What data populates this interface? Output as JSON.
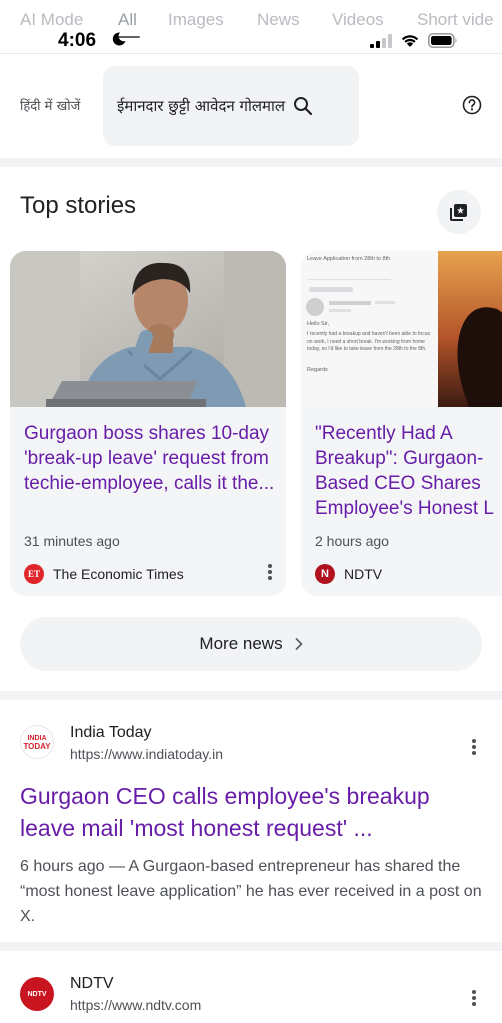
{
  "tabs": [
    "AI Mode",
    "All",
    "Images",
    "News",
    "Videos",
    "Short vide"
  ],
  "status": {
    "time": "4:06"
  },
  "search": {
    "hindi_label": "हिंदी में खोजें",
    "query": "ईमानदार छुट्टी आवेदन गोलमाल"
  },
  "top_stories": {
    "title": "Top stories",
    "cards": [
      {
        "title": "Gurgaon boss shares 10-day 'break-up leave' request from techie-employee, calls it the...",
        "time": "31 minutes ago",
        "source": "The Economic Times",
        "logo_text": "ET",
        "logo_color": "#e0252b"
      },
      {
        "title": "\"Recently Had A Breakup\": Gurgaon-Based CEO Shares Employee's Honest L",
        "time": "2 hours ago",
        "source": "NDTV",
        "logo_text": "N",
        "logo_color": "#b0121e"
      }
    ],
    "email_mock": {
      "subject": "Leave Application from 28th to 8th",
      "body": "I recently had a breakup and haven't been able to focus on work, I need a short break. I'm working from home today, so I'd like to take leave from the 28th to the 8th.",
      "greeting": "Hello Sir,",
      "signoff": "Regards"
    },
    "more_news": "More news"
  },
  "results": [
    {
      "site": "India Today",
      "url": "https://www.indiatoday.in",
      "title": "Gurgaon CEO calls employee's breakup leave mail 'most honest request' ...",
      "snippet": "6 hours ago — A Gurgaon-based entrepreneur has shared the “most honest leave application” he has ever received in a post on X.",
      "logo_color": "#d6232d"
    },
    {
      "site": "NDTV",
      "url": "https://www.ndtv.com",
      "logo_text": "NDTV",
      "logo_color": "#c8151f"
    }
  ],
  "colors": {
    "link_visited": "#681da8",
    "text_primary": "#202124",
    "text_secondary": "#4d5156",
    "card_bg": "#f4f5f6",
    "divider_band": "#f1f3f4"
  },
  "icons": [
    "moon-icon",
    "signal-icon",
    "wifi-icon",
    "battery-icon",
    "search-icon",
    "help-icon",
    "add-to-collection-icon",
    "chevron-right-icon",
    "more-vert-icon"
  ]
}
